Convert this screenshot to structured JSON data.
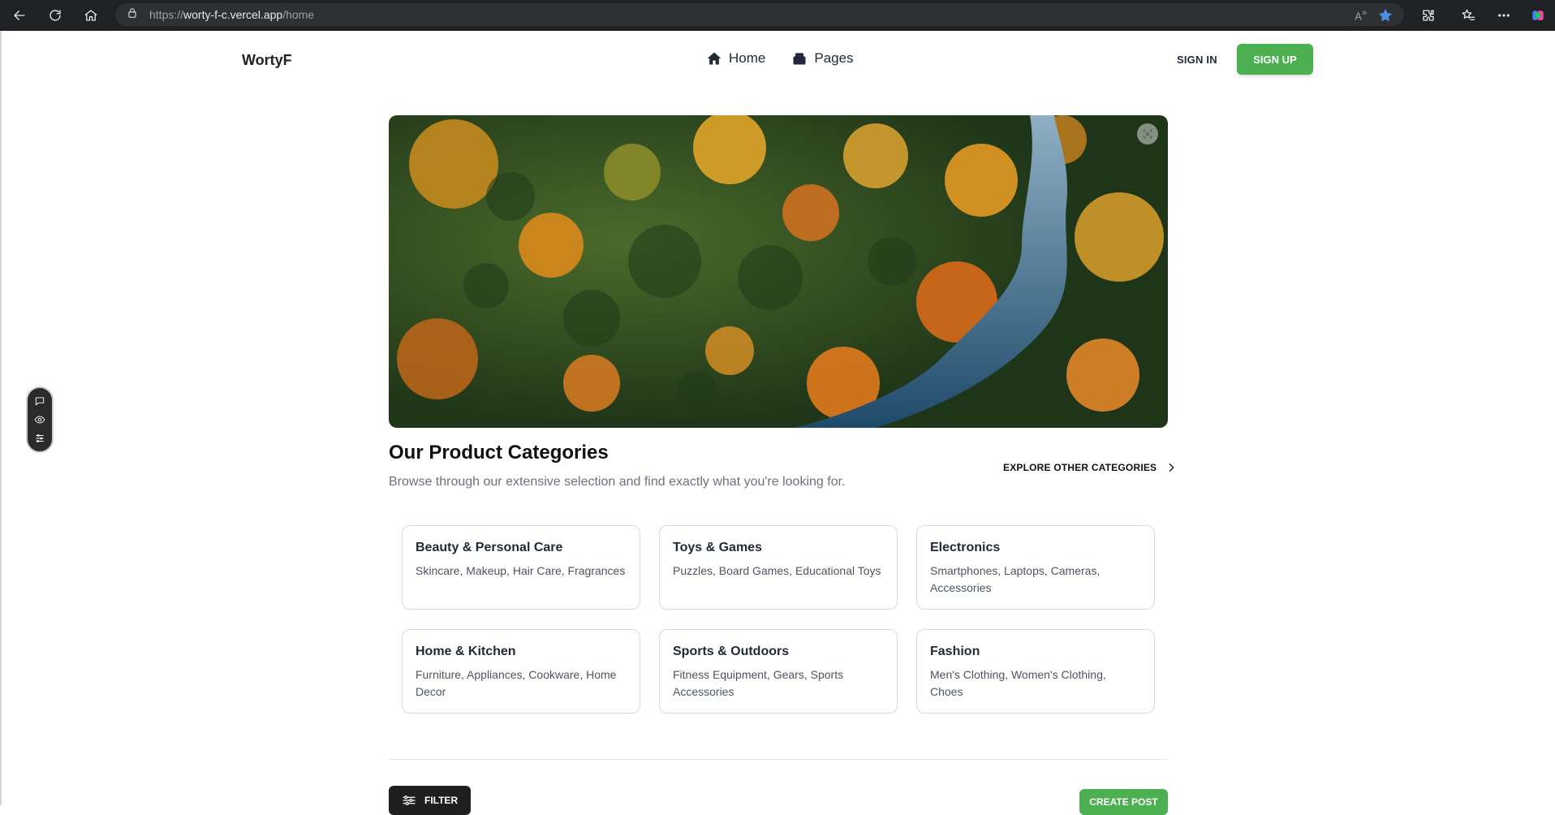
{
  "browser": {
    "url_scheme": "https://",
    "url_host": "worty-f-c.vercel.app",
    "url_path": "/home"
  },
  "header": {
    "brand": "WortyF",
    "nav": [
      {
        "label": "Home",
        "icon": "home-icon"
      },
      {
        "label": "Pages",
        "icon": "pages-icon"
      }
    ],
    "signin_label": "SIGN IN",
    "signup_label": "SIGN UP",
    "accent_color": "#4caf50"
  },
  "categories": {
    "title": "Our Product Categories",
    "subtitle": "Browse through our extensive selection and find exactly what you're looking for.",
    "explore_label": "EXPLORE OTHER CATEGORIES",
    "items": [
      {
        "title": "Beauty & Personal Care",
        "desc": "Skincare, Makeup, Hair Care, Fragrances"
      },
      {
        "title": "Toys & Games",
        "desc": "Puzzles, Board Games, Educational Toys"
      },
      {
        "title": "Electronics",
        "desc": "Smartphones, Laptops, Cameras, Accessories"
      },
      {
        "title": "Home & Kitchen",
        "desc": "Furniture, Appliances, Cookware, Home Decor"
      },
      {
        "title": "Sports & Outdoors",
        "desc": "Fitness Equipment, Gears, Sports Accessories"
      },
      {
        "title": "Fashion",
        "desc": "Men's Clothing, Women's Clothing, Choes"
      }
    ]
  },
  "actions": {
    "filter_label": "FILTER",
    "create_post_label": "CREATE POST"
  }
}
